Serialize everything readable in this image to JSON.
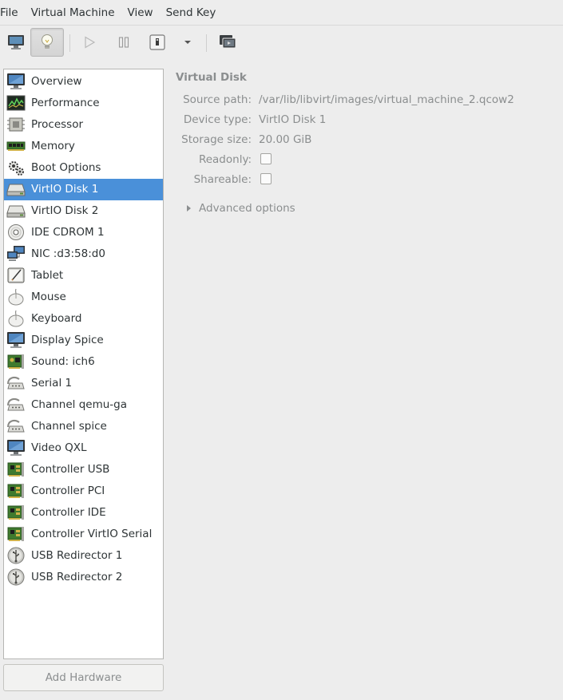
{
  "menubar": {
    "items": [
      "File",
      "Virtual Machine",
      "View",
      "Send Key"
    ]
  },
  "toolbar": {
    "buttons": [
      {
        "name": "console-icon",
        "active": false
      },
      {
        "name": "details-bulb-icon",
        "active": true
      },
      {
        "name": "run-icon",
        "active": false
      },
      {
        "name": "pause-icon",
        "active": false
      },
      {
        "name": "shutdown-icon",
        "active": false
      },
      {
        "name": "dropdown-arrow-icon",
        "active": false
      },
      {
        "name": "fullscreen-icon",
        "active": false
      }
    ]
  },
  "sidebar": {
    "items": [
      {
        "label": "Overview",
        "icon": "monitor-icon"
      },
      {
        "label": "Performance",
        "icon": "performance-graph-icon"
      },
      {
        "label": "Processor",
        "icon": "cpu-chip-icon"
      },
      {
        "label": "Memory",
        "icon": "memory-stick-icon"
      },
      {
        "label": "Boot Options",
        "icon": "gears-icon"
      },
      {
        "label": "VirtIO Disk 1",
        "icon": "hard-disk-icon",
        "selected": true
      },
      {
        "label": "VirtIO Disk 2",
        "icon": "hard-disk-icon"
      },
      {
        "label": "IDE CDROM 1",
        "icon": "cdrom-icon"
      },
      {
        "label": "NIC :d3:58:d0",
        "icon": "network-icon"
      },
      {
        "label": "Tablet",
        "icon": "tablet-icon"
      },
      {
        "label": "Mouse",
        "icon": "mouse-icon"
      },
      {
        "label": "Keyboard",
        "icon": "keyboard-icon"
      },
      {
        "label": "Display Spice",
        "icon": "monitor-icon"
      },
      {
        "label": "Sound: ich6",
        "icon": "sound-card-icon"
      },
      {
        "label": "Serial 1",
        "icon": "serial-port-icon"
      },
      {
        "label": "Channel qemu-ga",
        "icon": "serial-port-icon"
      },
      {
        "label": "Channel spice",
        "icon": "serial-port-icon"
      },
      {
        "label": "Video QXL",
        "icon": "monitor-icon"
      },
      {
        "label": "Controller USB",
        "icon": "controller-card-icon"
      },
      {
        "label": "Controller PCI",
        "icon": "controller-card-icon"
      },
      {
        "label": "Controller IDE",
        "icon": "controller-card-icon"
      },
      {
        "label": "Controller VirtIO Serial",
        "icon": "controller-card-icon"
      },
      {
        "label": "USB Redirector 1",
        "icon": "usb-icon"
      },
      {
        "label": "USB Redirector 2",
        "icon": "usb-icon"
      }
    ],
    "add_hardware_label": "Add Hardware"
  },
  "details": {
    "title": "Virtual Disk",
    "source_path_label": "Source path:",
    "source_path_value": "/var/lib/libvirt/images/virtual_machine_2.qcow2",
    "device_type_label": "Device type:",
    "device_type_value": "VirtIO Disk 1",
    "storage_size_label": "Storage size:",
    "storage_size_value": "20.00 GiB",
    "readonly_label": "Readonly:",
    "readonly_checked": false,
    "shareable_label": "Shareable:",
    "shareable_checked": false,
    "advanced_options_label": "Advanced options"
  },
  "colors": {
    "selection": "#4a90d9",
    "dimmed_text": "#8b8e8f"
  }
}
